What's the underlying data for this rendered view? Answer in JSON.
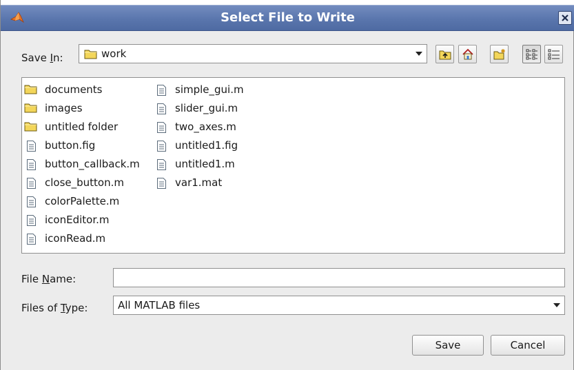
{
  "window": {
    "title": "Select File to Write"
  },
  "save_in": {
    "label_pre": "Save ",
    "label_mnemonic": "I",
    "label_post": "n:",
    "current": "work",
    "toolbar": [
      "up-one-level",
      "home",
      "create-new-folder",
      "list-view",
      "details-view"
    ]
  },
  "files": {
    "column1": [
      {
        "name": "documents",
        "type": "folder"
      },
      {
        "name": "images",
        "type": "folder"
      },
      {
        "name": "untitled folder",
        "type": "folder"
      },
      {
        "name": "button.fig",
        "type": "file"
      },
      {
        "name": "button_callback.m",
        "type": "file"
      },
      {
        "name": "close_button.m",
        "type": "file"
      },
      {
        "name": "colorPalette.m",
        "type": "file"
      },
      {
        "name": "iconEditor.m",
        "type": "file"
      },
      {
        "name": "iconRead.m",
        "type": "file"
      }
    ],
    "column2": [
      {
        "name": "simple_gui.m",
        "type": "file"
      },
      {
        "name": "slider_gui.m",
        "type": "file"
      },
      {
        "name": "two_axes.m",
        "type": "file"
      },
      {
        "name": "untitled1.fig",
        "type": "file"
      },
      {
        "name": "untitled1.m",
        "type": "file"
      },
      {
        "name": "var1.mat",
        "type": "file"
      }
    ]
  },
  "file_name": {
    "label_pre": "File ",
    "label_mnemonic": "N",
    "label_post": "ame:",
    "value": ""
  },
  "file_type": {
    "label_pre": "Files of ",
    "label_mnemonic": "T",
    "label_post": "ype:",
    "selected": "All MATLAB files"
  },
  "buttons": {
    "save": "Save",
    "cancel": "Cancel"
  },
  "colors": {
    "titlebar": "#5a76ad",
    "folder": "#f3d65a",
    "dialog_bg": "#ececec"
  }
}
